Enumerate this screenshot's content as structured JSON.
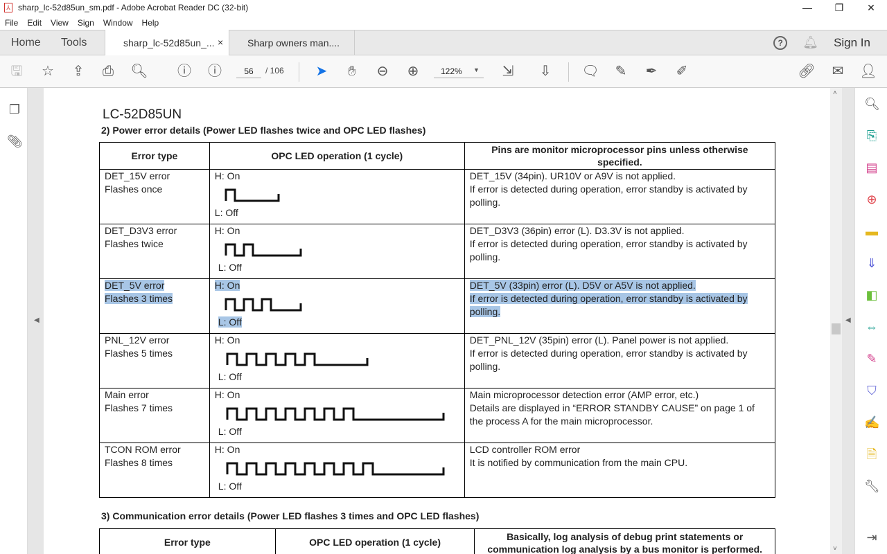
{
  "window": {
    "title": "sharp_lc-52d85un_sm.pdf - Adobe Acrobat Reader DC (32-bit)",
    "minimize": "—",
    "restore": "❐",
    "close": "✕"
  },
  "menu": [
    "File",
    "Edit",
    "View",
    "Sign",
    "Window",
    "Help"
  ],
  "tabs": {
    "home": "Home",
    "tools": "Tools",
    "active": "sharp_lc-52d85un_...",
    "active_close": "×",
    "other": "Sharp owners man....",
    "help": "?",
    "sign_in": "Sign In"
  },
  "toolbar": {
    "page_current": "56",
    "page_total": "/ 106",
    "zoom": "122%"
  },
  "document": {
    "model": "LC-52D85UN",
    "section2_title": "2) Power error details (Power LED flashes twice and OPC LED flashes)",
    "headers": [
      "Error type",
      "OPC LED operation (1 cycle)",
      "Pins are monitor microprocessor pins unless otherwise specified."
    ],
    "rows": [
      {
        "type": "DET_15V error",
        "flashes": "Flashes once",
        "high": "H: On",
        "low": "L: Off",
        "pulses": 1,
        "desc": [
          "DET_15V (34pin). UR10V or A9V is not applied.",
          "If error is detected during operation, error standby is activated by polling."
        ],
        "selected": false
      },
      {
        "type": "DET_D3V3 error",
        "flashes": "Flashes twice",
        "high": "H: On",
        "low": "L: Off",
        "pulses": 2,
        "desc": [
          "DET_D3V3 (36pin) error (L). D3.3V is not applied.",
          "If error is detected during operation, error standby is activated by polling."
        ],
        "selected": false
      },
      {
        "type": "DET_5V error",
        "flashes": "Flashes 3 times",
        "high": "H: On",
        "low": "L: Off",
        "pulses": 3,
        "desc": [
          "DET_5V (33pin) error (L). D5V or A5V is not applied.",
          "If error is detected during operation, error standby is activated by polling."
        ],
        "selected": true
      },
      {
        "type": "PNL_12V error",
        "flashes": "Flashes 5 times",
        "high": "H: On",
        "low": "L: Off",
        "pulses": 5,
        "desc": [
          "DET_PNL_12V (35pin) error (L). Panel power is not applied.",
          "If error is detected during operation, error standby is activated by polling."
        ],
        "selected": false
      },
      {
        "type": "Main error",
        "flashes": "Flashes 7 times",
        "high": "H: On",
        "low": "L: Off",
        "pulses": 7,
        "desc": [
          "Main microprocessor detection error (AMP error, etc.)",
          "Details are displayed in “ERROR STANDBY CAUSE” on page 1 of the process A for the main microprocessor."
        ],
        "selected": false
      },
      {
        "type": "TCON ROM error",
        "flashes": "Flashes 8 times",
        "high": "H: On",
        "low": "L: Off",
        "pulses": 8,
        "desc": [
          "LCD controller ROM error",
          "It is notified by communication from the main CPU."
        ],
        "selected": false
      }
    ],
    "section3_title": "3) Communication error details (Power LED flashes 3 times and OPC LED flashes)",
    "headers3": [
      "Error type",
      "OPC LED operation (1 cycle)",
      "Basically, log analysis of debug print statements or communication log analysis by a bus monitor is performed."
    ]
  }
}
